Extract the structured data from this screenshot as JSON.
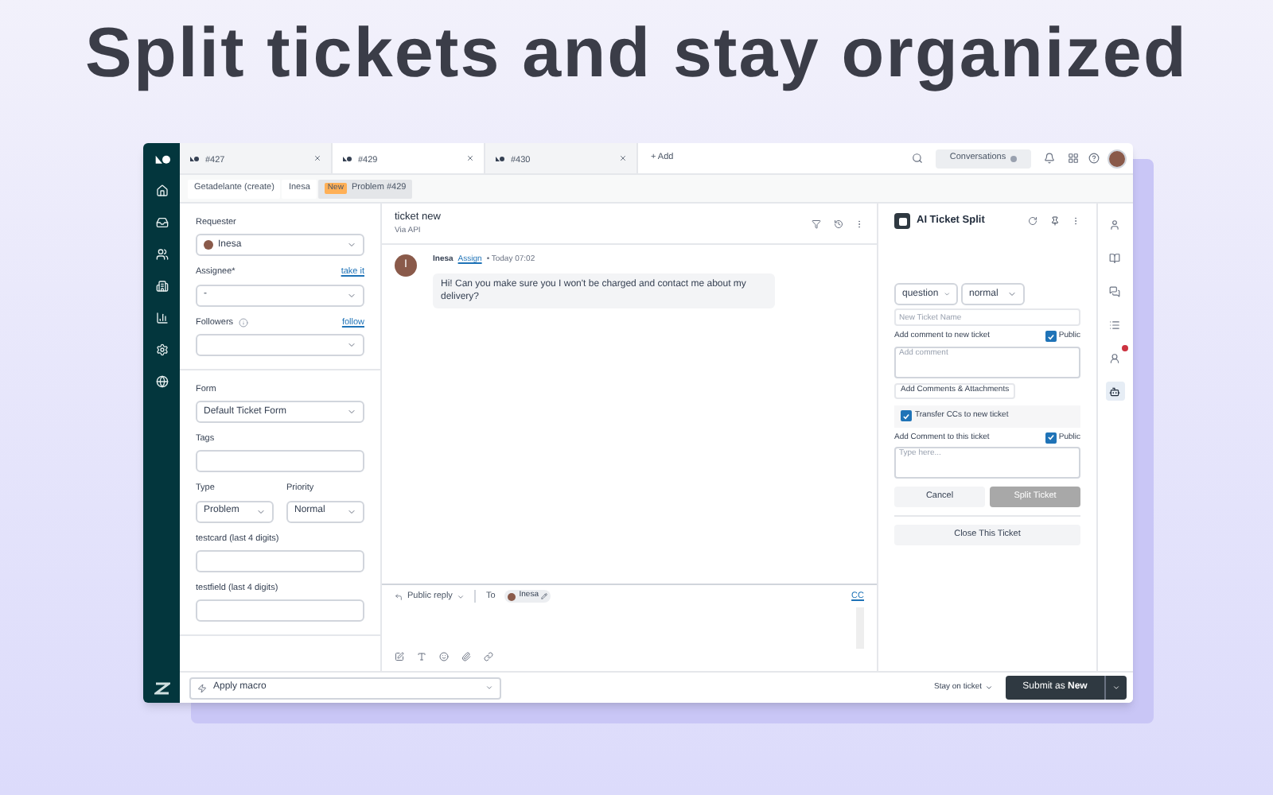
{
  "headline": "Split tickets and stay organized",
  "tabs": [
    {
      "label": "#427",
      "selected": false
    },
    {
      "label": "#429",
      "selected": true
    },
    {
      "label": "#430",
      "selected": false
    }
  ],
  "add_tab": "+ Add",
  "conversations_button": "Conversations",
  "breadcrumbs": [
    {
      "label": "Getadelante (create)",
      "selected": false
    },
    {
      "label": "Inesa",
      "selected": false
    },
    {
      "badge": "New",
      "label": "Problem #429",
      "selected": true
    }
  ],
  "fields": [
    {
      "kind": "select",
      "label": "Requester",
      "value": "Inesa",
      "avatar": true
    },
    {
      "kind": "select",
      "label": "Assignee*",
      "link": "take it",
      "value": "-"
    },
    {
      "kind": "select",
      "label": "Followers",
      "link": "follow",
      "info": true
    },
    {
      "kind": "divider"
    },
    {
      "kind": "select",
      "label": "Form",
      "value": "Default Ticket Form"
    },
    {
      "kind": "input",
      "label": "Tags"
    },
    {
      "kind": "pair",
      "items": [
        {
          "label": "Type",
          "value": "Problem"
        },
        {
          "label": "Priority",
          "value": "Normal"
        }
      ]
    },
    {
      "kind": "input",
      "label": "testcard (last 4 digits)"
    },
    {
      "kind": "input",
      "label": "testfield (last 4 digits)"
    }
  ],
  "conversation": {
    "title": "ticket new",
    "subtitle": "Via API",
    "message": {
      "avatar": "I",
      "author": "Inesa",
      "link": "Assign",
      "time": "• Today 07:02",
      "body": "Hi! Can you make sure you I won't be charged and contact me about my delivery?"
    }
  },
  "composer": {
    "mode": "Public reply",
    "to": "To",
    "recipient": "Inesa",
    "cc": "CC"
  },
  "app": {
    "title": "AI Ticket Split",
    "selects": [
      "question",
      "normal"
    ],
    "name_placeholder": "New Ticket Name",
    "comment_label": "Add comment to new ticket",
    "comment_public": {
      "label": "Public",
      "checked": true
    },
    "comment_placeholder": "Add comment",
    "attach_button": "Add Comments & Attachments",
    "transfer": {
      "label": "Transfer CCs to new ticket",
      "checked": true
    },
    "this_label": "Add Comment to this ticket",
    "this_public": {
      "label": "Public",
      "checked": true
    },
    "this_placeholder": "Type here...",
    "cancel": "Cancel",
    "split": {
      "label": "Split Ticket",
      "disabled": true
    },
    "close": "Close This Ticket"
  },
  "right_rail": [
    {
      "selected": false,
      "badge": false
    },
    {
      "selected": false,
      "badge": false
    },
    {
      "selected": false,
      "badge": false
    },
    {
      "selected": false,
      "badge": false
    },
    {
      "selected": false,
      "badge": true
    },
    {
      "selected": true,
      "badge": false
    }
  ],
  "bottom": {
    "macro": "Apply macro",
    "stay": "Stay on ticket",
    "submit": "Submit as **New**"
  }
}
